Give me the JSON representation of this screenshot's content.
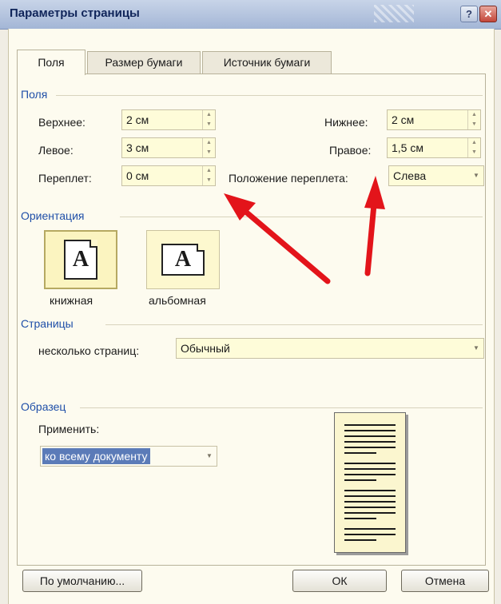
{
  "window": {
    "title": "Параметры страницы",
    "help_label": "?",
    "close_label": "✕"
  },
  "tabs": [
    {
      "label": "Поля",
      "active": true
    },
    {
      "label": "Размер бумаги",
      "active": false
    },
    {
      "label": "Источник бумаги",
      "active": false
    }
  ],
  "margins": {
    "section_title": "Поля",
    "top": {
      "label": "Верхнее:",
      "value": "2 см"
    },
    "bottom": {
      "label": "Нижнее:",
      "value": "2 см"
    },
    "left": {
      "label": "Левое:",
      "value": "3 см"
    },
    "right": {
      "label": "Правое:",
      "value": "1,5 см"
    },
    "gutter": {
      "label": "Переплет:",
      "value": "0 см"
    },
    "gutter_position": {
      "label": "Положение переплета:",
      "value": "Слева"
    }
  },
  "orientation": {
    "section_title": "Ориентация",
    "portrait": {
      "label": "книжная",
      "glyph": "A"
    },
    "landscape": {
      "label": "альбомная",
      "glyph": "A"
    },
    "selected": "portrait"
  },
  "pages": {
    "section_title": "Страницы",
    "multiple_label": "несколько страниц:",
    "multiple_value": "Обычный"
  },
  "preview": {
    "section_title": "Образец",
    "apply_label": "Применить:",
    "apply_value": "ко всему документу"
  },
  "buttons": {
    "default": "По умолчанию...",
    "ok": "ОК",
    "cancel": "Отмена"
  },
  "colors": {
    "section_title": "#1f4fa8",
    "input_bg": "#fefcd9",
    "annotation_arrow": "#e3141a"
  }
}
